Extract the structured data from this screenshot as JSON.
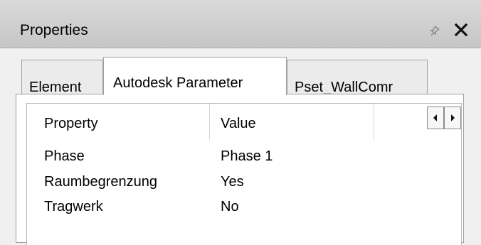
{
  "panel": {
    "title": "Properties"
  },
  "tabs": [
    {
      "label": "Element",
      "active": false
    },
    {
      "label": "Autodesk Parameter",
      "active": true
    },
    {
      "label": "Pset_WallCommonParameters",
      "visible_text": "Pset_WallComr",
      "active": false
    }
  ],
  "table": {
    "headers": [
      "Property",
      "Value"
    ],
    "rows": [
      {
        "property": "Phase",
        "value": "Phase 1"
      },
      {
        "property": "Raumbegrenzung",
        "value": "Yes"
      },
      {
        "property": "Tragwerk",
        "value": "No"
      }
    ]
  },
  "icons": {
    "pin": "pin-icon",
    "close": "close-icon",
    "scroll_left": "scroll-left-icon",
    "scroll_right": "scroll-right-icon"
  },
  "colors": {
    "titlebar": "#cfcfcf",
    "background": "#f0f0f0",
    "content": "#ffffff",
    "border": "#a0a0a0"
  }
}
